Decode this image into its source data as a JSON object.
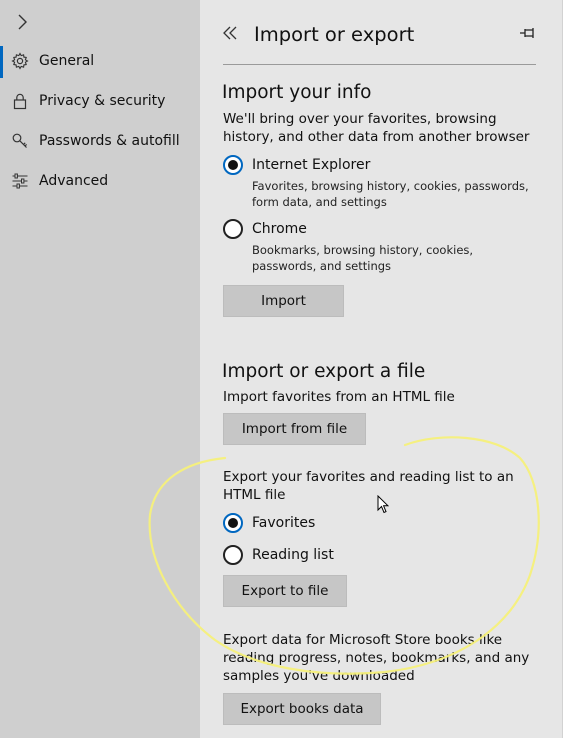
{
  "sidebar": {
    "items": [
      {
        "label": "General",
        "icon": "gear-icon",
        "selected": true
      },
      {
        "label": "Privacy & security",
        "icon": "lock-icon",
        "selected": false
      },
      {
        "label": "Passwords & autofill",
        "icon": "key-icon",
        "selected": false
      },
      {
        "label": "Advanced",
        "icon": "sliders-icon",
        "selected": false
      }
    ]
  },
  "panel": {
    "title": "Import or export",
    "import_info": {
      "heading": "Import your info",
      "description": "We'll bring over your favorites, browsing history, and other data from another browser",
      "options": [
        {
          "label": "Internet Explorer",
          "description": "Favorites, browsing history, cookies, passwords, form data, and settings",
          "checked": true
        },
        {
          "label": "Chrome",
          "description": "Bookmarks, browsing history, cookies, passwords, and settings",
          "checked": false
        }
      ],
      "button": "Import"
    },
    "import_export_file": {
      "heading": "Import or export a file",
      "import_description": "Import favorites from an HTML file",
      "import_button": "Import from file",
      "export_description": "Export your favorites and reading list to an HTML file",
      "export_options": [
        {
          "label": "Favorites",
          "checked": true
        },
        {
          "label": "Reading list",
          "checked": false
        }
      ],
      "export_button": "Export to file"
    },
    "books": {
      "description": "Export data for Microsoft Store books like reading progress, notes, bookmarks, and any samples you've downloaded",
      "button": "Export books data"
    }
  },
  "colors": {
    "accent": "#0067c0",
    "annotation": "#f5f07a"
  }
}
